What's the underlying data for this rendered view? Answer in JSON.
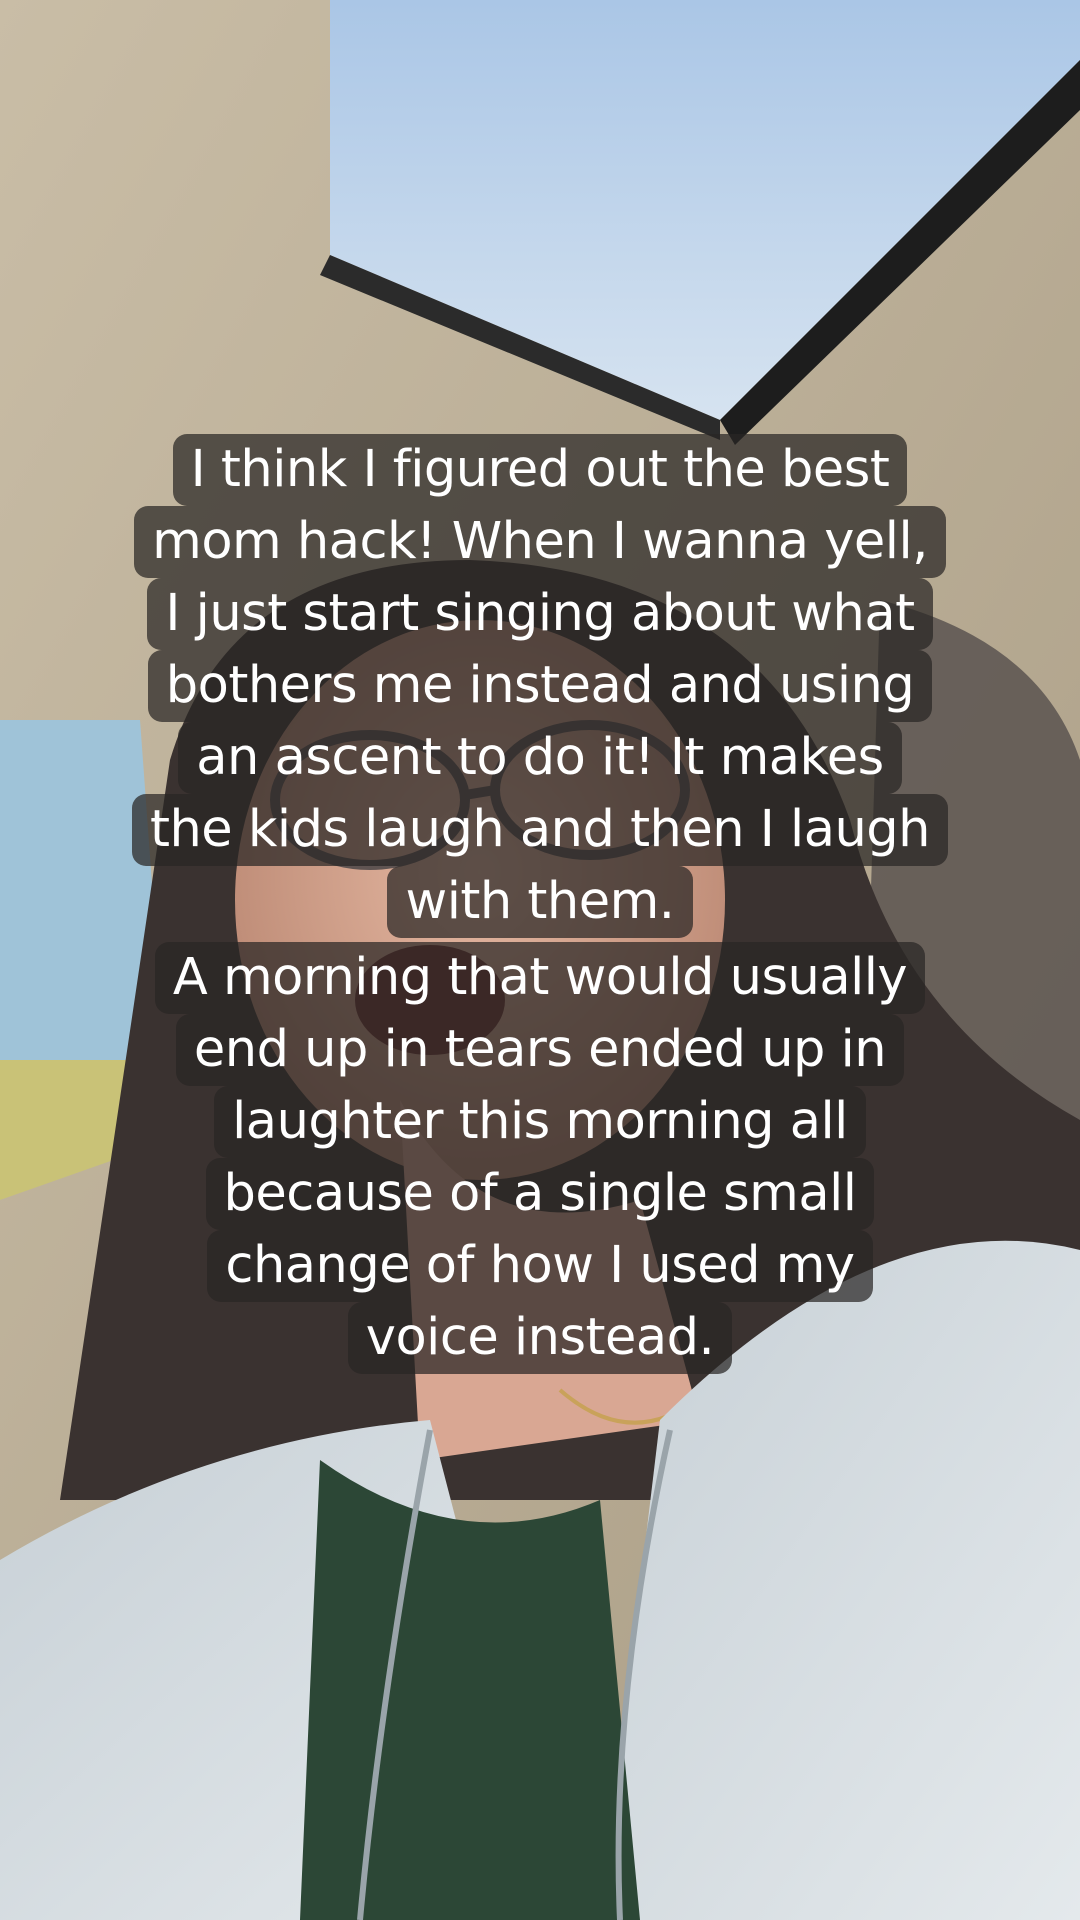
{
  "video": {
    "scene_icon": "selfie-in-car-photo"
  },
  "caption": {
    "lines": [
      "I think I figured out the best",
      "mom hack! When I wanna yell,",
      "I just start singing about what",
      "bothers me instead and using",
      "an ascent to do it! It makes",
      "the kids laugh and then I laugh",
      "with them.",
      "A morning that would usually",
      "end up in tears ended up in",
      "laughter this morning all",
      "because of a single small",
      "change of how I used my",
      "voice instead."
    ],
    "text_color": "#ffffff",
    "background_color": "#282624"
  }
}
